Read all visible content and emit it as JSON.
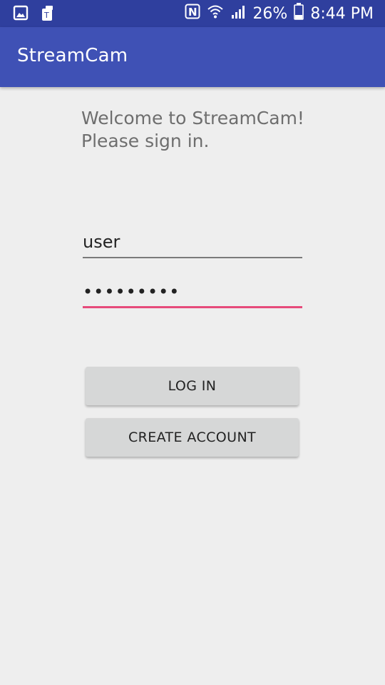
{
  "status_bar": {
    "icons_left": [
      "gallery-icon",
      "app-notification-icon"
    ],
    "nfc_label": "N",
    "battery_percent": "26%",
    "time": "8:44 PM"
  },
  "toolbar": {
    "title": "StreamCam"
  },
  "welcome": {
    "line1": "Welcome to StreamCam!",
    "line2": "Please sign in."
  },
  "form": {
    "username_value": "user",
    "password_value": "•••••••••"
  },
  "buttons": {
    "login_label": "LOG IN",
    "create_account_label": "CREATE ACCOUNT"
  },
  "colors": {
    "status_bar": "#2f3f9e",
    "toolbar": "#3f51b5",
    "accent": "#e64a7b",
    "background": "#eeeeee",
    "button": "#d6d7d7"
  }
}
